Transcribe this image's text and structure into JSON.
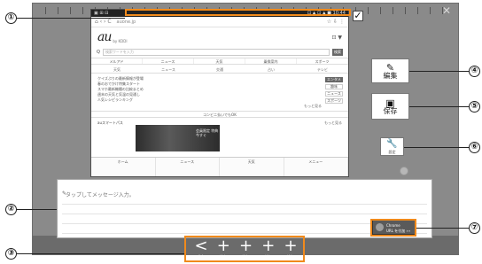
{
  "callouts": [
    "①",
    "②",
    "③",
    "④",
    "⑤",
    "⑥",
    "⑦"
  ],
  "screenshot": {
    "status_left": "▣ ⊞ ⊟",
    "status_right": "⊡ ▲ ⊡ ▲ ■ 10:44",
    "url_icons": "⌂ ‹ › C",
    "url": "auone.jp",
    "url_actions": "☆ ⇩ ⋮",
    "logo": "au",
    "logo_tag": "by KDDI",
    "top_icons": "⊡ ▼",
    "search_placeholder": "検索ワードを入力",
    "search_button": "検索",
    "nav": [
      "メルアド",
      "ニュース",
      "天気",
      "乗換案内",
      "スポーツ"
    ],
    "tabs": [
      "天気",
      "ニュース",
      "交通",
      "占い",
      "テレビ"
    ],
    "news_lines": [
      "クイズぷりの最新情報が登場",
      "春のおでかけ特集スタート",
      "スマホ最新機種の比較まとめ",
      "週末の天気と気温の見通し",
      "人気レシピランキング"
    ],
    "news_side": [
      "エンタメ",
      "趣味",
      "ニュース",
      "スポーツ"
    ],
    "news_footer": "もっと見る",
    "banner": "コンビニ払いでもOK",
    "smart_title": "auスマートパス",
    "smart_more": "もっと見る",
    "smart_img_text": "会員限定 特典 今すぐ",
    "footer": [
      "ホーム",
      "ニュース",
      "天気",
      "メニュー"
    ]
  },
  "buttons": {
    "edit_label": "編集",
    "save_label": "保存",
    "settings_label": "設定"
  },
  "message": {
    "placeholder": "タップしてメッセージ入力。"
  },
  "clipper": {
    "line1": "Chrome",
    "line2": "URL を付加 ›››"
  },
  "toolbar": [
    {
      "glyph": "<",
      "label": "共有"
    },
    {
      "glyph": "+",
      "label": "追加"
    },
    {
      "glyph": "+",
      "label": "追加"
    },
    {
      "glyph": "+",
      "label": "追加"
    },
    {
      "glyph": "+",
      "label": "追加"
    }
  ],
  "colors": {
    "highlight": "#f08a1c",
    "frame": "#8a8a8a",
    "toolbar": "#6b6b6b"
  }
}
